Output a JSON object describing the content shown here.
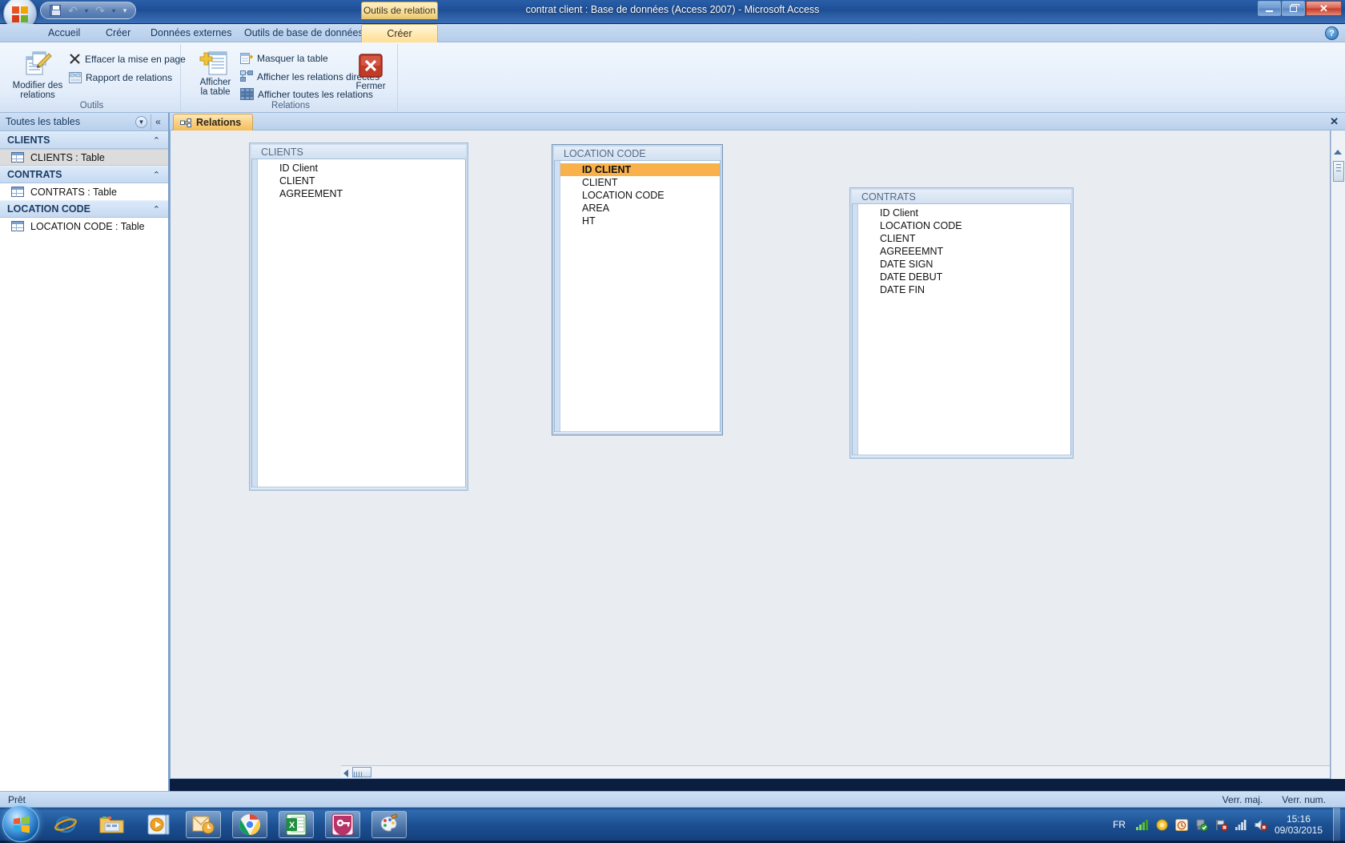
{
  "window": {
    "title": "contrat client : Base de données (Access 2007) - Microsoft Access",
    "context_tab": "Outils de relation",
    "minimize_label": "Réduire",
    "restore_label": "Restaurer",
    "close_label": "✕",
    "help_label": "?"
  },
  "quick_access": {
    "save_icon": "save-icon",
    "undo_icon": "undo-icon",
    "redo_icon": "redo-icon",
    "customize_icon": "chevron-down-icon"
  },
  "ribbon": {
    "tabs": [
      {
        "label": "Accueil",
        "active": false
      },
      {
        "label": "Créer",
        "active": false
      },
      {
        "label": "Données externes",
        "active": false
      },
      {
        "label": "Outils de base de données",
        "active": false
      },
      {
        "label": "Créer",
        "active": true
      }
    ],
    "groups": [
      {
        "title": "Outils",
        "big_button": {
          "line1": "Modifier des",
          "line2": "relations",
          "icon": "edit-relationships-icon"
        },
        "items": [
          {
            "label": "Effacer la mise en page",
            "icon": "clear-layout-icon"
          },
          {
            "label": "Rapport de relations",
            "icon": "relationship-report-icon"
          }
        ]
      },
      {
        "title": "Relations",
        "big_button": {
          "line1": "Afficher",
          "line2": "la table",
          "icon": "show-table-icon"
        },
        "items": [
          {
            "label": "Masquer la table",
            "icon": "hide-table-icon"
          },
          {
            "label": "Afficher les relations directes",
            "icon": "direct-relationships-icon"
          },
          {
            "label": "Afficher toutes les relations",
            "icon": "all-relationships-icon"
          }
        ],
        "close_button": {
          "label": "Fermer",
          "icon": "close-red-icon"
        }
      }
    ]
  },
  "navpane": {
    "header": "Toutes les tables",
    "dropdown_icon": "chevron-down-icon",
    "collapse_icon": "double-chevron-left-icon",
    "groups": [
      {
        "name": "CLIENTS",
        "chevron": "⌃",
        "items": [
          {
            "label": "CLIENTS : Table",
            "selected": true
          }
        ]
      },
      {
        "name": "CONTRATS",
        "chevron": "⌃",
        "items": [
          {
            "label": "CONTRATS : Table",
            "selected": false
          }
        ]
      },
      {
        "name": "LOCATION CODE",
        "chevron": "⌃",
        "items": [
          {
            "label": "LOCATION CODE : Table",
            "selected": false
          }
        ]
      }
    ]
  },
  "document_tab": {
    "label": "Relations",
    "icon": "relationships-icon",
    "close_label": "✕"
  },
  "canvas": {
    "tables": [
      {
        "name": "CLIENTS",
        "fields": [
          {
            "label": "ID Client",
            "highlighted": false
          },
          {
            "label": "CLIENT",
            "highlighted": false
          },
          {
            "label": "AGREEMENT",
            "highlighted": false
          }
        ]
      },
      {
        "name": "LOCATION CODE",
        "fields": [
          {
            "label": "ID CLIENT",
            "highlighted": true
          },
          {
            "label": "CLIENT",
            "highlighted": false
          },
          {
            "label": "LOCATION CODE",
            "highlighted": false
          },
          {
            "label": "AREA",
            "highlighted": false
          },
          {
            "label": "HT",
            "highlighted": false
          }
        ]
      },
      {
        "name": "CONTRATS",
        "fields": [
          {
            "label": "ID Client",
            "highlighted": false
          },
          {
            "label": "LOCATION CODE",
            "highlighted": false
          },
          {
            "label": "CLIENT",
            "highlighted": false
          },
          {
            "label": "AGREEEMNT",
            "highlighted": false
          },
          {
            "label": "DATE SIGN",
            "highlighted": false
          },
          {
            "label": "DATE DEBUT",
            "highlighted": false
          },
          {
            "label": "DATE FIN",
            "highlighted": false
          }
        ]
      }
    ],
    "highlight_color": "#f9b24b"
  },
  "statusbar": {
    "message": "Prêt",
    "caps_lock": "Verr. maj.",
    "num_lock": "Verr. num."
  },
  "taskbar": {
    "start_icon": "windows-start-icon",
    "items": [
      {
        "name": "internet-explorer-icon",
        "boxed": false
      },
      {
        "name": "file-explorer-icon",
        "boxed": false
      },
      {
        "name": "media-player-icon",
        "boxed": false
      },
      {
        "name": "outlook-icon",
        "boxed": true
      },
      {
        "name": "chrome-icon",
        "boxed": true
      },
      {
        "name": "excel-icon",
        "boxed": true
      },
      {
        "name": "access-icon",
        "boxed": true
      },
      {
        "name": "paint-icon",
        "boxed": true
      }
    ],
    "tray": {
      "language": "FR",
      "icons": [
        "signal-bars-icon",
        "shield-yellow-icon",
        "action-center-icon",
        "drive-ok-icon",
        "network-error-icon",
        "wifi-bars-icon",
        "volume-muted-icon"
      ],
      "time": "15:16",
      "date": "09/03/2015"
    }
  }
}
